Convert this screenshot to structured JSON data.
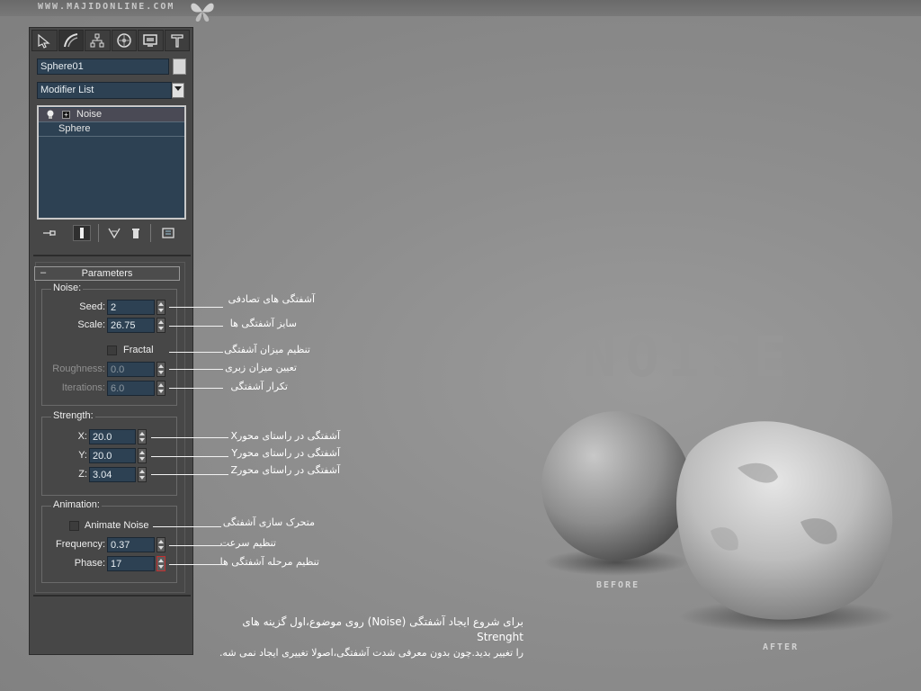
{
  "watermark": "WWW.MAJIDONLINE.COM",
  "panel": {
    "object_name": "Sphere01",
    "object_color": "#d7d7d7",
    "modifier_list": "Modifier List",
    "stack": [
      "Noise",
      "Sphere"
    ],
    "rollout_title": "Parameters",
    "rollout_toggle": "–",
    "noise": {
      "group": "Noise:",
      "seed_label": "Seed:",
      "seed": "2",
      "scale_label": "Scale:",
      "scale": "26.75",
      "fractal_label": "Fractal",
      "roughness_label": "Roughness:",
      "roughness": "0.0",
      "iterations_label": "Iterations:",
      "iterations": "6.0"
    },
    "strength": {
      "group": "Strength:",
      "x_label": "X:",
      "x": "20.0",
      "y_label": "Y:",
      "y": "20.0",
      "z_label": "Z:",
      "z": "3.04"
    },
    "animation": {
      "group": "Animation:",
      "animate_label": "Animate Noise",
      "frequency_label": "Frequency:",
      "frequency": "0.37",
      "phase_label": "Phase:",
      "phase": "17"
    }
  },
  "annotations": {
    "seed": "آشفتگی های تصادفی",
    "scale": "سایز آشفتگی ها",
    "fractal": "تنظیم میزان آشفتگی",
    "roughness": "تعیین میزان زبری",
    "iterations": "تکرار آشفتگی",
    "x": "آشفتگی در راستای محورX",
    "y": "آشفتگی در راستای محورY",
    "z": "آشفتگی در راستای محورZ",
    "animate": "متحرک سازی آشفتگی",
    "frequency": "تنظیم سرعت",
    "phase": "تنظیم مرحله آشفتگی ها"
  },
  "caption_line1": "برای شروع ایجاد آشفتگی (Noise) روی موضوع،اول گزینه های Strenght",
  "caption_line2": "را تغییر بدید.چون بدون معرفی شدت آشفتگی،اصولا تغییری ایجاد نمی شه.",
  "render": {
    "title": "NOISE",
    "before": "BEFORE",
    "after": "AFTER"
  }
}
